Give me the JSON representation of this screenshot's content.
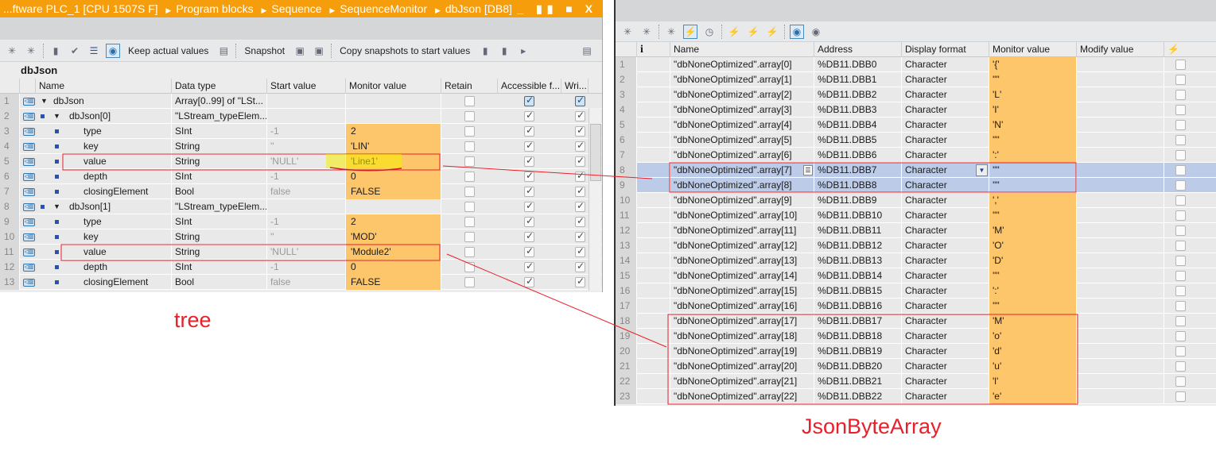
{
  "left": {
    "title": "...ftware PLC_1 [CPU 1507S F]",
    "breadcrumb": [
      "Program blocks",
      "Sequence",
      "SequenceMonitor",
      "dbJson [DB8]"
    ],
    "window_controls": "_ ▮▮ ■ X",
    "toolbar": {
      "keep_actual": "Keep actual values",
      "snapshot": "Snapshot",
      "copy_snapshots": "Copy snapshots to start values"
    },
    "section": "dbJson",
    "columns": [
      "Name",
      "Data type",
      "Start value",
      "Monitor value",
      "Retain",
      "Accessible f...",
      "Wri..."
    ],
    "rows": [
      {
        "n": "1",
        "level": 0,
        "expand": true,
        "name": "dbJson",
        "type": "Array[0..99] of \"LSt...",
        "start": "",
        "monitor": "",
        "acc_blue": true
      },
      {
        "n": "2",
        "level": 1,
        "expand": true,
        "name": "dbJson[0]",
        "type": "\"LStream_typeElem...",
        "start": "",
        "monitor": ""
      },
      {
        "n": "3",
        "level": 2,
        "name": "type",
        "type": "SInt",
        "start": "-1",
        "monitor": "2"
      },
      {
        "n": "4",
        "level": 2,
        "name": "key",
        "type": "String",
        "start": "''",
        "monitor": "'LIN'"
      },
      {
        "n": "5",
        "level": 2,
        "name": "value",
        "type": "String",
        "start": "'NULL'",
        "monitor": "'Line1'",
        "highlight": true
      },
      {
        "n": "6",
        "level": 2,
        "name": "depth",
        "type": "SInt",
        "start": "-1",
        "monitor": "0"
      },
      {
        "n": "7",
        "level": 2,
        "name": "closingElement",
        "type": "Bool",
        "start": "false",
        "monitor": "FALSE"
      },
      {
        "n": "8",
        "level": 1,
        "expand": true,
        "name": "dbJson[1]",
        "type": "\"LStream_typeElem...",
        "start": "",
        "monitor": ""
      },
      {
        "n": "9",
        "level": 2,
        "name": "type",
        "type": "SInt",
        "start": "-1",
        "monitor": "2"
      },
      {
        "n": "10",
        "level": 2,
        "name": "key",
        "type": "String",
        "start": "''",
        "monitor": "'MOD'"
      },
      {
        "n": "11",
        "level": 2,
        "name": "value",
        "type": "String",
        "start": "'NULL'",
        "monitor": "'Module2'"
      },
      {
        "n": "12",
        "level": 2,
        "name": "depth",
        "type": "SInt",
        "start": "-1",
        "monitor": "0"
      },
      {
        "n": "13",
        "level": 2,
        "name": "closingElement",
        "type": "Bool",
        "start": "false",
        "monitor": "FALSE"
      }
    ]
  },
  "right": {
    "columns": [
      "Name",
      "Address",
      "Display format",
      "Monitor value",
      "Modify value"
    ],
    "info_col": "i",
    "rows": [
      {
        "n": "1",
        "name": "\"dbNoneOptimized\".array[0]",
        "addr": "%DB11.DBB0",
        "fmt": "Character",
        "mon": "'{'"
      },
      {
        "n": "2",
        "name": "\"dbNoneOptimized\".array[1]",
        "addr": "%DB11.DBB1",
        "fmt": "Character",
        "mon": "'\"'"
      },
      {
        "n": "3",
        "name": "\"dbNoneOptimized\".array[2]",
        "addr": "%DB11.DBB2",
        "fmt": "Character",
        "mon": "'L'"
      },
      {
        "n": "4",
        "name": "\"dbNoneOptimized\".array[3]",
        "addr": "%DB11.DBB3",
        "fmt": "Character",
        "mon": "'I'"
      },
      {
        "n": "5",
        "name": "\"dbNoneOptimized\".array[4]",
        "addr": "%DB11.DBB4",
        "fmt": "Character",
        "mon": "'N'"
      },
      {
        "n": "6",
        "name": "\"dbNoneOptimized\".array[5]",
        "addr": "%DB11.DBB5",
        "fmt": "Character",
        "mon": "'\"'"
      },
      {
        "n": "7",
        "name": "\"dbNoneOptimized\".array[6]",
        "addr": "%DB11.DBB6",
        "fmt": "Character",
        "mon": "':'"
      },
      {
        "n": "8",
        "name": "\"dbNoneOptimized\".array[7]",
        "addr": "%DB11.DBB7",
        "fmt": "Character",
        "mon": "'\"'",
        "selected": true
      },
      {
        "n": "9",
        "name": "\"dbNoneOptimized\".array[8]",
        "addr": "%DB11.DBB8",
        "fmt": "Character",
        "mon": "'\"'",
        "selected": true
      },
      {
        "n": "10",
        "name": "\"dbNoneOptimized\".array[9]",
        "addr": "%DB11.DBB9",
        "fmt": "Character",
        "mon": "','"
      },
      {
        "n": "11",
        "name": "\"dbNoneOptimized\".array[10]",
        "addr": "%DB11.DBB10",
        "fmt": "Character",
        "mon": "'\"'"
      },
      {
        "n": "12",
        "name": "\"dbNoneOptimized\".array[11]",
        "addr": "%DB11.DBB11",
        "fmt": "Character",
        "mon": "'M'"
      },
      {
        "n": "13",
        "name": "\"dbNoneOptimized\".array[12]",
        "addr": "%DB11.DBB12",
        "fmt": "Character",
        "mon": "'O'"
      },
      {
        "n": "14",
        "name": "\"dbNoneOptimized\".array[13]",
        "addr": "%DB11.DBB13",
        "fmt": "Character",
        "mon": "'D'"
      },
      {
        "n": "15",
        "name": "\"dbNoneOptimized\".array[14]",
        "addr": "%DB11.DBB14",
        "fmt": "Character",
        "mon": "'\"'"
      },
      {
        "n": "16",
        "name": "\"dbNoneOptimized\".array[15]",
        "addr": "%DB11.DBB15",
        "fmt": "Character",
        "mon": "':'"
      },
      {
        "n": "17",
        "name": "\"dbNoneOptimized\".array[16]",
        "addr": "%DB11.DBB16",
        "fmt": "Character",
        "mon": "'\"'"
      },
      {
        "n": "18",
        "name": "\"dbNoneOptimized\".array[17]",
        "addr": "%DB11.DBB17",
        "fmt": "Character",
        "mon": "'M'"
      },
      {
        "n": "19",
        "name": "\"dbNoneOptimized\".array[18]",
        "addr": "%DB11.DBB18",
        "fmt": "Character",
        "mon": "'o'"
      },
      {
        "n": "20",
        "name": "\"dbNoneOptimized\".array[19]",
        "addr": "%DB11.DBB19",
        "fmt": "Character",
        "mon": "'d'"
      },
      {
        "n": "21",
        "name": "\"dbNoneOptimized\".array[20]",
        "addr": "%DB11.DBB20",
        "fmt": "Character",
        "mon": "'u'"
      },
      {
        "n": "22",
        "name": "\"dbNoneOptimized\".array[21]",
        "addr": "%DB11.DBB21",
        "fmt": "Character",
        "mon": "'l'"
      },
      {
        "n": "23",
        "name": "\"dbNoneOptimized\".array[22]",
        "addr": "%DB11.DBB22",
        "fmt": "Character",
        "mon": "'e'"
      }
    ]
  },
  "annotations": {
    "tree": "tree",
    "json": "JsonByteArray"
  },
  "colors": {
    "title": "#f59d0b",
    "monitor": "#fec66a",
    "annotation": "#e8202a",
    "selection": "#bccbe7"
  }
}
